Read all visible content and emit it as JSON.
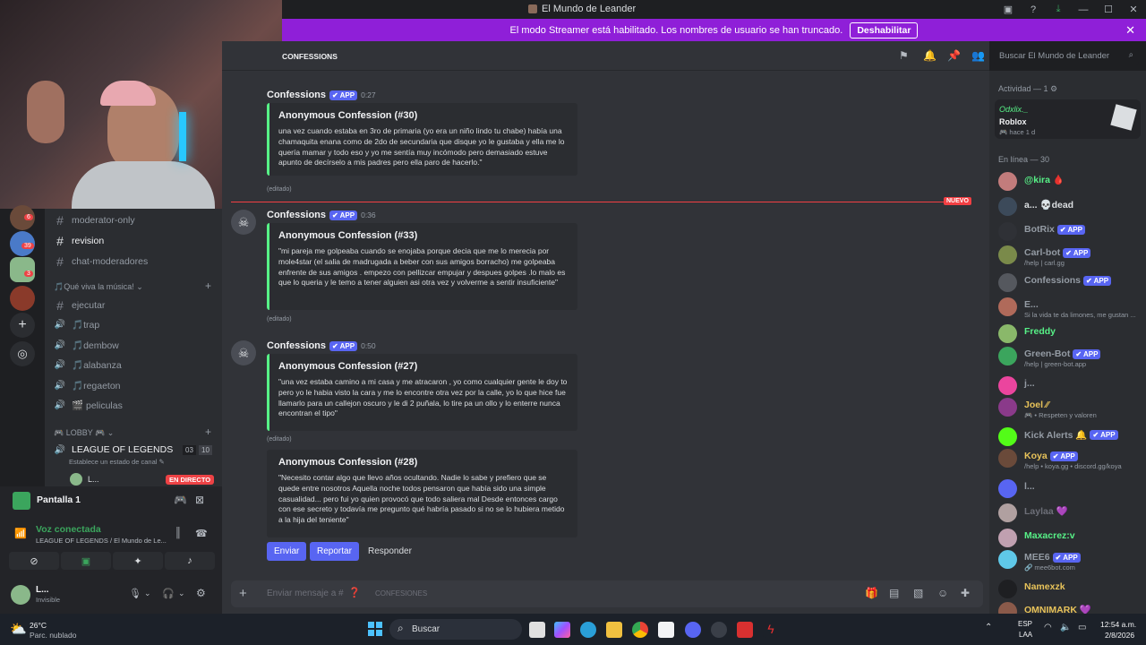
{
  "window": {
    "title": "El Mundo de Leander"
  },
  "streamer_banner": {
    "text": "El modo Streamer está habilitado. Los nombres de usuario se han truncado.",
    "button": "Deshabilitar"
  },
  "channel_header": {
    "name": "CONFESSIONS",
    "search_placeholder": "Buscar El Mundo de Leander"
  },
  "sidebar": {
    "channels": [
      {
        "icon": "#",
        "label": "moderator-only"
      },
      {
        "icon": "#",
        "label": "revision"
      },
      {
        "icon": "#",
        "label": "chat-moderadores"
      }
    ],
    "category_music": "🎵Qué viva la música! ⌄",
    "music_channels": [
      {
        "icon": "#",
        "label": "ejecutar"
      },
      {
        "icon": "🔊",
        "label": "🎵trap"
      },
      {
        "icon": "🔊",
        "label": "🎵dembow"
      },
      {
        "icon": "🔊",
        "label": "🎵alabanza"
      },
      {
        "icon": "🔊",
        "label": "🎵regaeton"
      },
      {
        "icon": "🔊",
        "label": "🎬 peliculas"
      }
    ],
    "category_lobby": "🎮 LOBBY 🎮 ⌄",
    "voice_channel": {
      "label": "LEAGUE OF LEGENDS",
      "count_a": "03",
      "count_b": "10",
      "status": "Establece un estado de canal ✎"
    },
    "voice_user": {
      "name": "L...",
      "badge": "EN DIRECTO"
    },
    "server_badges": [
      "6",
      "39",
      "3"
    ]
  },
  "user_panel": {
    "screen_share": "Pantalla 1",
    "voice_status": "Voz conectada",
    "voice_location": "LEAGUE OF LEGENDS / El Mundo de Le...",
    "user_name": "L...",
    "user_status": "Invisible"
  },
  "messages": [
    {
      "author": "Confessions",
      "tag": "✔ APP",
      "time": "0:27",
      "embed_title": "Anonymous Confession (#30)",
      "embed_body": "una vez cuando estaba en 3ro de primaria (yo era un niño lindo tu chabe) había una chamaquita enana como de 2do de secundaria que disque yo le gustaba y ella me lo quería mamar y todo eso y yo me sentía muy incómodo pero demasiado estuve apunto de decírselo a mis padres pero ella paro de hacerlo.\"",
      "edited": "(editado)"
    },
    {
      "author": "Confessions",
      "tag": "✔ APP",
      "time": "0:36",
      "embed_title": "Anonymous Confession (#33)",
      "embed_body": "\"mi pareja me golpeaba cuando se enojaba porque decia que me lo merecia por mole4star (el salia de madrugada a beber con sus amigos borracho) me golpeaba enfrente de sus amigos . empezo con pellizcar empujar y despues golpes .lo malo es que lo queria y le temo a tener alguien asi otra vez y volverme a sentir insuficiente\"",
      "edited": "(editado)"
    },
    {
      "author": "Confessions",
      "tag": "✔ APP",
      "time": "0:50",
      "embed_title": "Anonymous Confession (#27)",
      "embed_body": "\"una vez estaba camino a mi casa y me atracaron , yo como cualquier gente le doy to pero yo le habia visto la cara y me lo encontre otra vez por la calle, yo lo que hice fue llamarlo para un callejon oscuro y le di 2 puñala, lo tire pa un ollo y lo enterre nunca encontran el tipo\"",
      "edited": "(editado)"
    },
    {
      "embed_title": "Anonymous Confession (#28)",
      "embed_body": "\"Necesito contar algo que llevo años ocultando. Nadie lo sabe y prefiero que se quede entre nosotros Aquella noche todos pensaron que había sido una simple casualidad... pero fui yo quien provocó que todo saliera mal Desde entonces cargo con ese secreto y todavía me pregunto qué habría pasado si no se lo hubiera metido a la hija del teniente\""
    }
  ],
  "new_divider": "NUEVO",
  "action_buttons": [
    "Enviar",
    "Reportar",
    "Responder"
  ],
  "composer": {
    "placeholder": "Enviar mensaje a #",
    "channel": "CONFESIONES"
  },
  "members": {
    "activity_header": "Actividad — 1 ⚙",
    "activity": {
      "user": "Odxlix._",
      "game": "Roblox",
      "time": "🎮 hace 1 d"
    },
    "online_header": "En línea — 30",
    "list": [
      {
        "name": "@kira 🩸",
        "status": "",
        "color": "#57f287",
        "avatar": "#c27c7c"
      },
      {
        "name": "a... 💀dead",
        "status": "",
        "color": "#dbdee1",
        "avatar": "#3c4a5a"
      },
      {
        "name": "BotRix",
        "tag": "✔ APP",
        "status": "",
        "color": "#949ba4",
        "avatar": "#2f3136"
      },
      {
        "name": "Carl-bot",
        "tag": "✔ APP",
        "status": "/help | carl.gg",
        "color": "#949ba4",
        "avatar": "#7a8a4a"
      },
      {
        "name": "Confessions",
        "tag": "✔ APP",
        "status": "",
        "color": "#949ba4",
        "avatar": "#55585e"
      },
      {
        "name": "E...",
        "status": "Si la vida te da limones, me gustan ...",
        "color": "#949ba4",
        "avatar": "#b06a5a"
      },
      {
        "name": "Freddy",
        "status": "",
        "color": "#57f287",
        "avatar": "#8ab86a"
      },
      {
        "name": "Green-Bot",
        "tag": "✔ APP",
        "status": "/help | green-bot.app",
        "color": "#949ba4",
        "avatar": "#3ba55d"
      },
      {
        "name": "j...",
        "status": "",
        "color": "#949ba4",
        "avatar": "#eb459e"
      },
      {
        "name": "Joel ⁄⁄",
        "status": "🎮 • Respeten y valoren",
        "color": "#e8c35a",
        "avatar": "#8a3a8a"
      },
      {
        "name": "Kick Alerts 🔔",
        "tag": "✔ APP",
        "status": "",
        "color": "#949ba4",
        "avatar": "#53fc18"
      },
      {
        "name": "Koya",
        "tag": "✔ APP",
        "status": "/help • koya.gg • discord.gg/koya",
        "color": "#e8c35a",
        "avatar": "#6a4a3a"
      },
      {
        "name": "l...",
        "status": "",
        "color": "#949ba4",
        "avatar": "#5865f2"
      },
      {
        "name": "Laylaa 💜",
        "status": "",
        "color": "#6d6f78",
        "avatar": "#b0a0a0"
      },
      {
        "name": "Maxacrez:v",
        "status": "",
        "color": "#57f287",
        "avatar": "#c0a0b0"
      },
      {
        "name": "MEE6",
        "tag": "✔ APP",
        "status": "🔗 mee6bot.com",
        "color": "#949ba4",
        "avatar": "#5fc8e8"
      },
      {
        "name": "Namexzk",
        "status": "",
        "color": "#e8c35a",
        "avatar": "#1e1f22"
      },
      {
        "name": "OMNIMARK 💜",
        "status": "",
        "color": "#e8c35a",
        "avatar": "#8a5a4a"
      }
    ]
  },
  "taskbar": {
    "weather_temp": "26°C",
    "weather_desc": "Parc. nublado",
    "search": "Buscar",
    "lang_a": "ESP",
    "lang_b": "LAA",
    "time": "12:54 a.m.",
    "date": "2/8/2026"
  }
}
